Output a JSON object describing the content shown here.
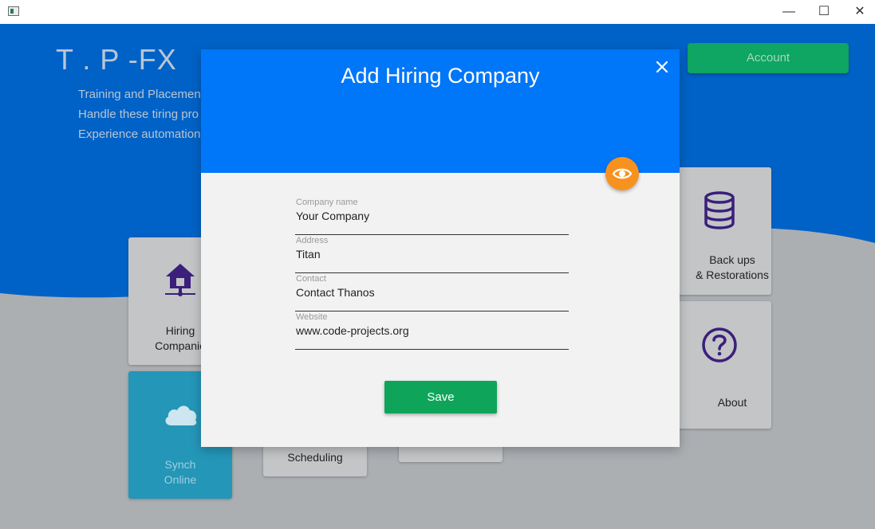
{
  "window": {
    "minimize_glyph": "—",
    "maximize_glyph": "☐",
    "close_glyph": "✕"
  },
  "app": {
    "title": "T . P -FX",
    "tagline": [
      "Training and Placement",
      "Handle these tiring pro",
      "Experience automation"
    ],
    "account_label": "Account"
  },
  "tiles": {
    "hiring": {
      "line1": "Hiring",
      "line2": "Companie",
      "icon": "house-network-icon"
    },
    "synch": {
      "line1": "Synch",
      "line2": "Online",
      "icon": "cloud-icon"
    },
    "scheduling": {
      "label": "Scheduling"
    },
    "backup": {
      "line1": "Back ups",
      "line2": "& Restorations",
      "icon": "database-icon"
    },
    "about": {
      "label": "About",
      "icon": "question-circle-icon"
    }
  },
  "modal": {
    "title": "Add Hiring Company",
    "close_glyph": "✕",
    "fields": [
      {
        "label": "Company name",
        "value": "Your Company"
      },
      {
        "label": "Address",
        "value": "Titan"
      },
      {
        "label": "Contact",
        "value": "Contact Thanos"
      },
      {
        "label": "Website",
        "value": "www.code-projects.org"
      }
    ],
    "save_label": "Save",
    "fab_icon": "eye-icon"
  },
  "colors": {
    "header_blue": "#0076f8",
    "background_blue": "#0062c6",
    "save_green": "#0ea55b",
    "fab_orange": "#f7921f",
    "tile_teal": "#2496b8"
  }
}
